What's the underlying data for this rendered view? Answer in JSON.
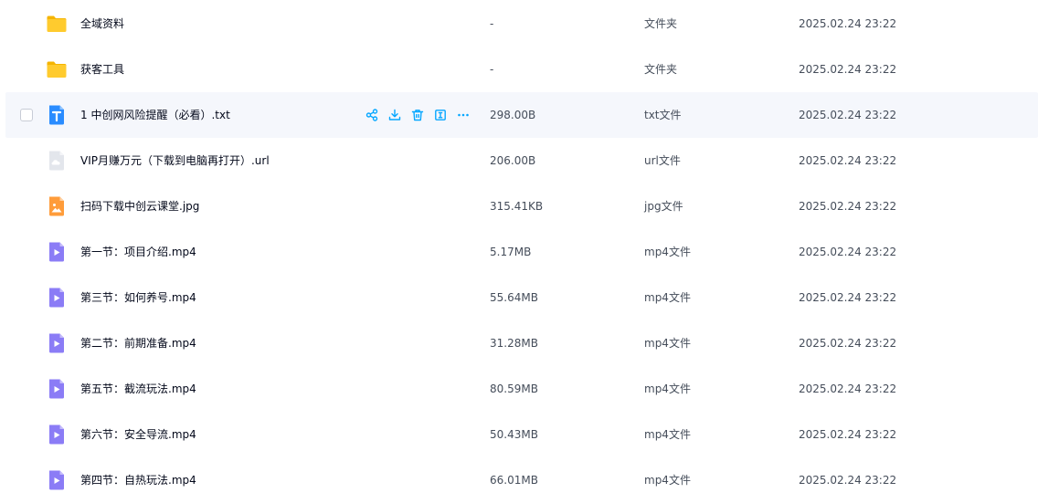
{
  "accent": "#06a7ff",
  "files": [
    {
      "name": "全域资料",
      "size": "-",
      "type": "文件夹",
      "date": "2025.02.24 23:22",
      "icon": "folder-icon"
    },
    {
      "name": "获客工具",
      "size": "-",
      "type": "文件夹",
      "date": "2025.02.24 23:22",
      "icon": "folder-icon"
    },
    {
      "name": "1 中创网风险提醒（必看）.txt",
      "size": "298.00B",
      "type": "txt文件",
      "date": "2025.02.24 23:22",
      "icon": "txt-file-icon",
      "hovered": true
    },
    {
      "name": "VIP月赚万元（下载到电脑再打开）.url",
      "size": "206.00B",
      "type": "url文件",
      "date": "2025.02.24 23:22",
      "icon": "url-file-icon"
    },
    {
      "name": "扫码下载中创云课堂.jpg",
      "size": "315.41KB",
      "type": "jpg文件",
      "date": "2025.02.24 23:22",
      "icon": "image-file-icon"
    },
    {
      "name": "第一节：项目介绍.mp4",
      "size": "5.17MB",
      "type": "mp4文件",
      "date": "2025.02.24 23:22",
      "icon": "video-file-icon"
    },
    {
      "name": "第三节：如何养号.mp4",
      "size": "55.64MB",
      "type": "mp4文件",
      "date": "2025.02.24 23:22",
      "icon": "video-file-icon"
    },
    {
      "name": "第二节：前期准备.mp4",
      "size": "31.28MB",
      "type": "mp4文件",
      "date": "2025.02.24 23:22",
      "icon": "video-file-icon"
    },
    {
      "name": "第五节：截流玩法.mp4",
      "size": "80.59MB",
      "type": "mp4文件",
      "date": "2025.02.24 23:22",
      "icon": "video-file-icon"
    },
    {
      "name": "第六节：安全导流.mp4",
      "size": "50.43MB",
      "type": "mp4文件",
      "date": "2025.02.24 23:22",
      "icon": "video-file-icon"
    },
    {
      "name": "第四节：自热玩法.mp4",
      "size": "66.01MB",
      "type": "mp4文件",
      "date": "2025.02.24 23:22",
      "icon": "video-file-icon"
    }
  ],
  "hover_actions": [
    "share-icon",
    "download-icon",
    "delete-icon",
    "rename-icon",
    "more-icon"
  ]
}
